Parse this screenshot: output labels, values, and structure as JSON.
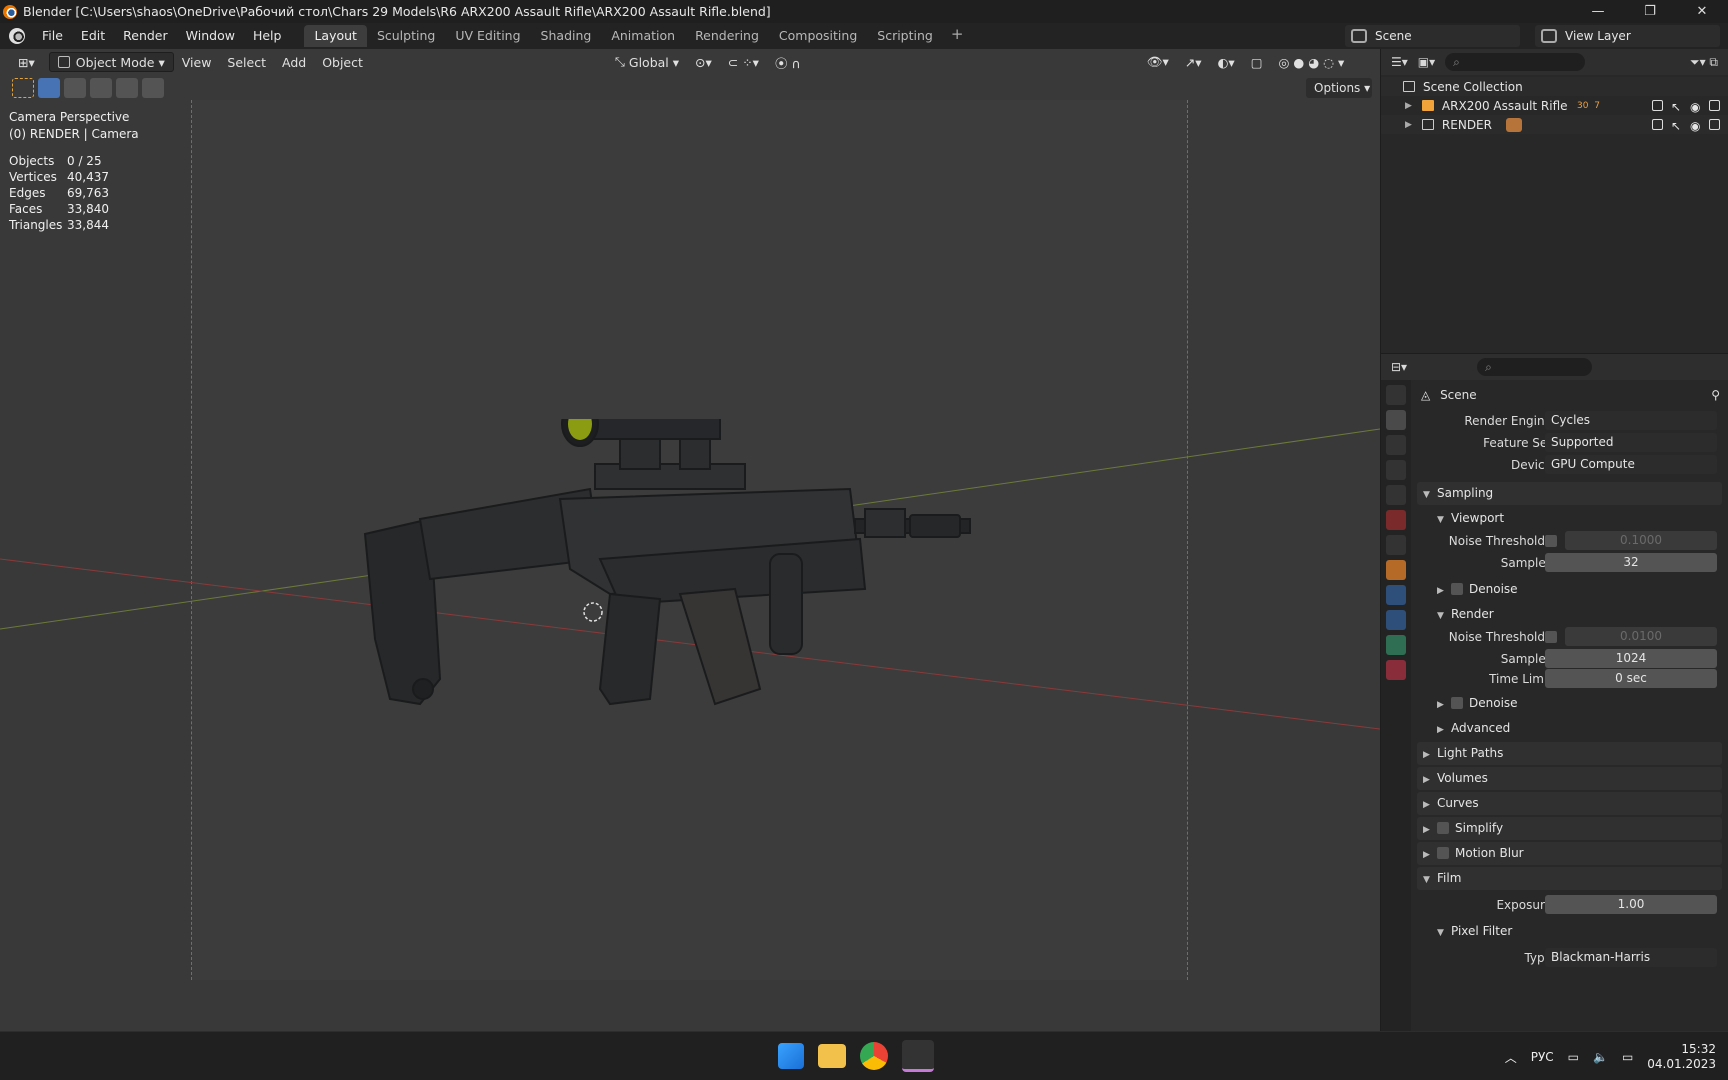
{
  "window": {
    "title": "Blender [C:\\Users\\shaos\\OneDrive\\Рабочий стол\\Chars 29 Models\\R6 ARX200 Assault Rifle\\ARX200 Assault Rifle.blend]"
  },
  "menu": [
    "File",
    "Edit",
    "Render",
    "Window",
    "Help"
  ],
  "workspaces": [
    "Layout",
    "Sculpting",
    "UV Editing",
    "Shading",
    "Animation",
    "Rendering",
    "Compositing",
    "Scripting"
  ],
  "active_workspace": "Layout",
  "scene": "Scene",
  "view_layer": "View Layer",
  "viewport": {
    "mode": "Object Mode",
    "view": "View",
    "select": "Select",
    "add": "Add",
    "object": "Object",
    "orientation": "Global",
    "options": "Options",
    "overlay_title": "Camera Perspective",
    "overlay_sub": "(0) RENDER | Camera",
    "stats": [
      {
        "k": "Objects",
        "v": "0 / 25"
      },
      {
        "k": "Vertices",
        "v": "40,437"
      },
      {
        "k": "Edges",
        "v": "69,763"
      },
      {
        "k": "Faces",
        "v": "33,840"
      },
      {
        "k": "Triangles",
        "v": "33,844"
      }
    ]
  },
  "outliner": {
    "root": "Scene Collection",
    "items": [
      "ARX200 Assault Rifle",
      "RENDER"
    ],
    "badge1": "30",
    "badge2": "7"
  },
  "properties": {
    "context": "Scene",
    "render_engine_label": "Render Engine",
    "render_engine": "Cycles",
    "feature_set_label": "Feature Set",
    "feature_set": "Supported",
    "device_label": "Device",
    "device": "GPU Compute",
    "sampling": "Sampling",
    "viewport": "Viewport",
    "noise_threshold_label": "Noise Threshold",
    "vp_noise": "0.1000",
    "samples_label": "Samples",
    "vp_samples": "32",
    "denoise": "Denoise",
    "render": "Render",
    "r_noise": "0.0100",
    "r_samples": "1024",
    "time_limit_label": "Time Limit",
    "time_limit": "0 sec",
    "advanced": "Advanced",
    "light_paths": "Light Paths",
    "volumes": "Volumes",
    "curves": "Curves",
    "simplify": "Simplify",
    "motion_blur": "Motion Blur",
    "film": "Film",
    "exposure_label": "Exposure",
    "exposure": "1.00",
    "pixel_filter": "Pixel Filter",
    "type_label": "Type",
    "type": "Blackman-Harris"
  },
  "taskbar": {
    "lang": "РУС",
    "time": "15:32",
    "date": "04.01.2023"
  }
}
